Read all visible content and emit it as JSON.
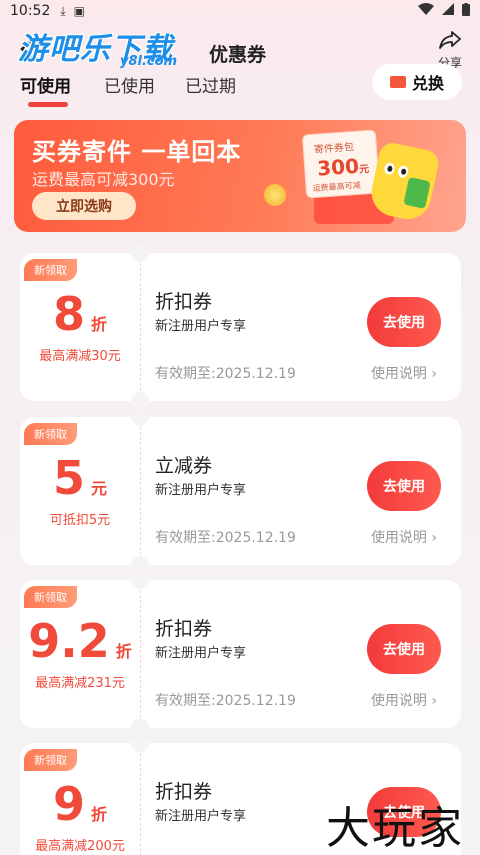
{
  "status_bar": {
    "time": "10:52"
  },
  "header": {
    "logo_main": "游吧乐下载",
    "logo_sub": "y8l.com",
    "title": "优惠券",
    "share_label": "分享"
  },
  "tabs": [
    {
      "label": "可使用",
      "active": true
    },
    {
      "label": "已使用",
      "active": false
    },
    {
      "label": "已过期",
      "active": false
    }
  ],
  "redeem_label": "兑换",
  "banner": {
    "title": "买券寄件  一单回本",
    "subtitle": "运费最高可减300元",
    "button": "立即选购",
    "pkg_label": "寄件券包",
    "pkg_amount": "300",
    "pkg_unit": "元",
    "pkg_note": "运费最高可减"
  },
  "coupons": [
    {
      "badge": "新领取",
      "amount": "8",
      "unit": "折",
      "condition": "最高满减30元",
      "title": "折扣券",
      "subtitle": "新注册用户专享",
      "expiry": "有效期至:2025.12.19",
      "rule": "使用说明",
      "button": "去使用"
    },
    {
      "badge": "新领取",
      "amount": "5",
      "unit": "元",
      "condition": "可抵扣5元",
      "title": "立减券",
      "subtitle": "新注册用户专享",
      "expiry": "有效期至:2025.12.19",
      "rule": "使用说明",
      "button": "去使用"
    },
    {
      "badge": "新领取",
      "amount": "9.2",
      "unit": "折",
      "condition": "最高满减231元",
      "title": "折扣券",
      "subtitle": "新注册用户专享",
      "expiry": "有效期至:2025.12.19",
      "rule": "使用说明",
      "button": "去使用"
    },
    {
      "badge": "新领取",
      "amount": "9",
      "unit": "折",
      "condition": "最高满减200元",
      "title": "折扣券",
      "subtitle": "新注册用户专享",
      "expiry": "",
      "rule": "",
      "button": "去使用"
    }
  ],
  "watermark": "大玩家",
  "colors": {
    "accent": "#f04a3a",
    "brand_blue": "#1d8fe8",
    "button_red": "#f23a3a"
  }
}
